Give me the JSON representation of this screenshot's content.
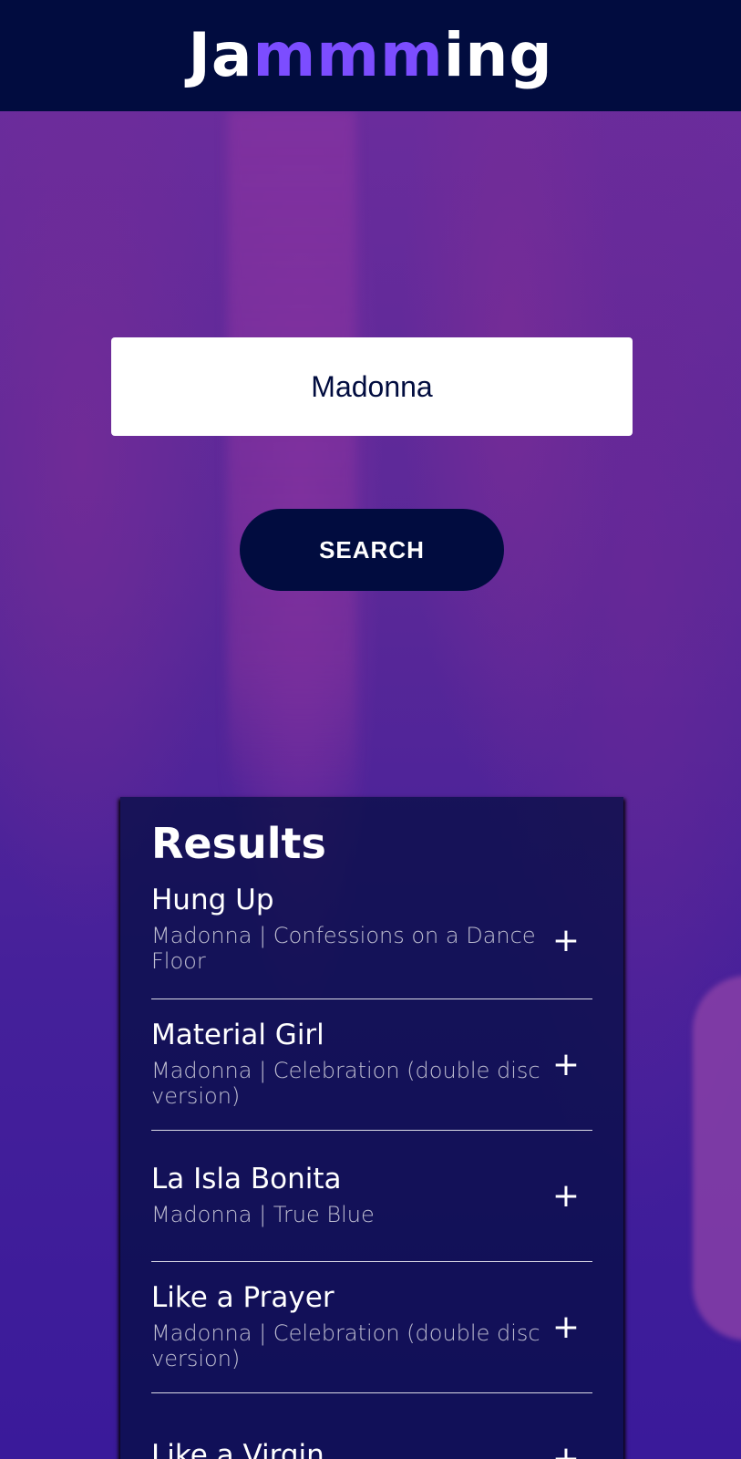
{
  "app": {
    "logo_prefix": "Ja",
    "logo_accent": "mmm",
    "logo_suffix": "ing",
    "accent_color": "#7c4dff",
    "header_color": "#010c3f"
  },
  "search": {
    "value": "Madonna",
    "button_label": "SEARCH"
  },
  "results": {
    "title": "Results",
    "add_icon": "+",
    "tracks": [
      {
        "name": "Hung Up",
        "subtitle": "Madonna | Confessions on a Dance Floor"
      },
      {
        "name": "Material Girl",
        "subtitle": "Madonna | Celebration (double disc version)"
      },
      {
        "name": "La Isla Bonita",
        "subtitle": "Madonna | True Blue"
      },
      {
        "name": "Like a Prayer",
        "subtitle": "Madonna | Celebration (double disc version)"
      },
      {
        "name": "Like a Virgin",
        "subtitle": ""
      }
    ]
  }
}
